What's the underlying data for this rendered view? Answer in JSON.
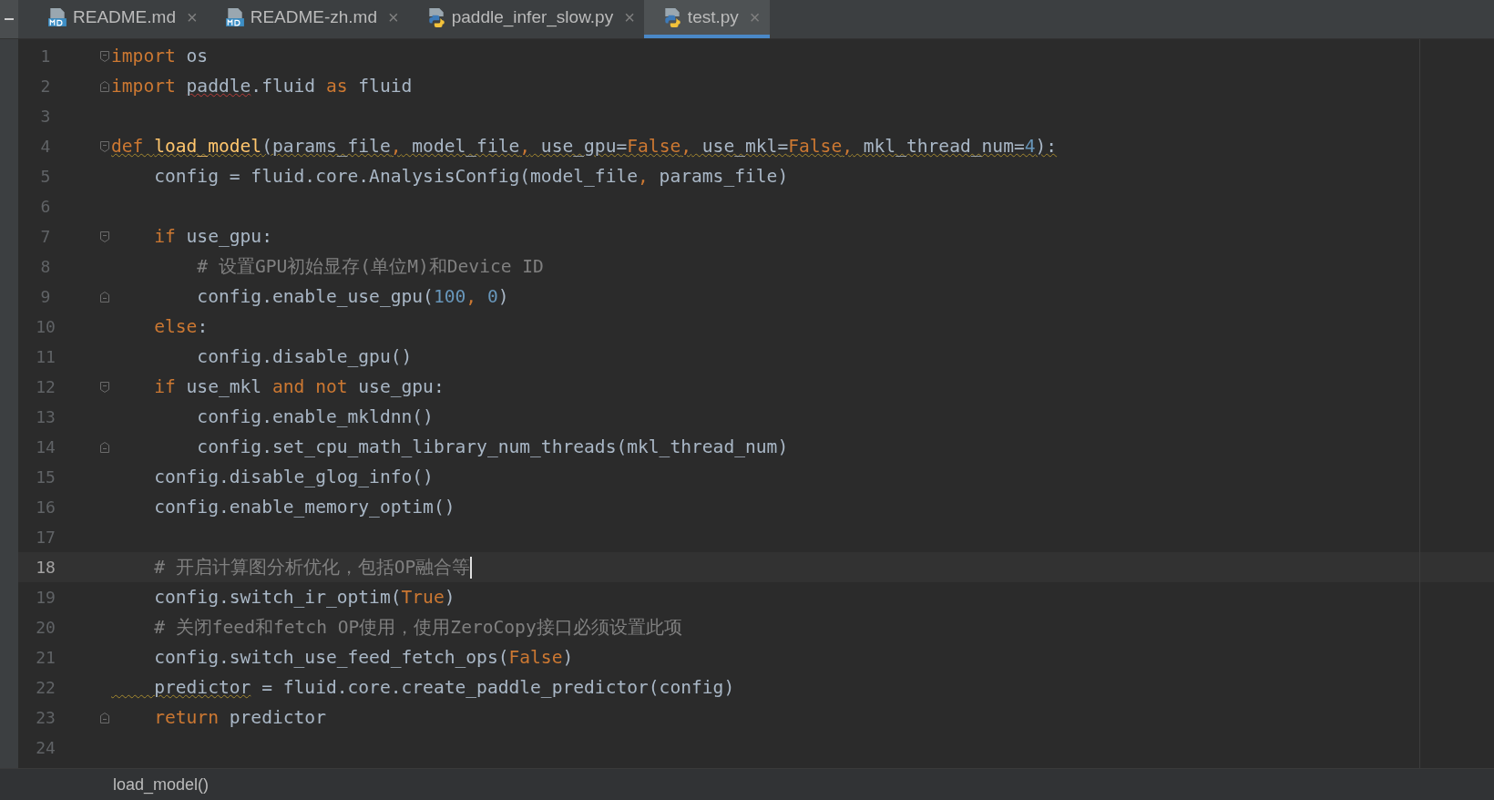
{
  "tabs": [
    {
      "label": "README.md",
      "kind": "md",
      "close": "×",
      "selected": false
    },
    {
      "label": "README-zh.md",
      "kind": "md",
      "close": "×",
      "selected": false
    },
    {
      "label": "paddle_infer_slow.py",
      "kind": "py",
      "close": "×",
      "selected": false
    },
    {
      "label": "test.py",
      "kind": "py",
      "close": "×",
      "selected": true
    }
  ],
  "editor": {
    "lines": [
      {
        "number": "1",
        "kind": "fold-start",
        "current": false,
        "tokens": [
          {
            "text": "import",
            "kind": "kw"
          },
          {
            "text": " os",
            "kind": "txt"
          }
        ]
      },
      {
        "number": "2",
        "kind": "fold-end",
        "current": false,
        "tokens": [
          {
            "text": "import ",
            "kind": "kw"
          },
          {
            "text": "paddle",
            "kind": "typo"
          },
          {
            "text": ".fluid ",
            "kind": "txt"
          },
          {
            "text": "as",
            "kind": "kw"
          },
          {
            "text": " fluid",
            "kind": "txt"
          }
        ]
      },
      {
        "number": "3",
        "kind": "plain",
        "current": false
      },
      {
        "number": "4",
        "kind": "fold-start",
        "current": false,
        "tokens": [
          {
            "text": "def ",
            "kind": "kw-warn"
          },
          {
            "text": "load_model",
            "kind": "fn-warn"
          },
          {
            "text": "(params_file",
            "kind": "warn"
          },
          {
            "text": ",",
            "kind": "kw-warn"
          },
          {
            "text": " model_file",
            "kind": "warn"
          },
          {
            "text": ",",
            "kind": "kw-warn"
          },
          {
            "text": " use_gpu=",
            "kind": "warn"
          },
          {
            "text": "False",
            "kind": "kw-warn"
          },
          {
            "text": ",",
            "kind": "kw-warn"
          },
          {
            "text": " use_mkl=",
            "kind": "warn"
          },
          {
            "text": "False",
            "kind": "kw-warn"
          },
          {
            "text": ",",
            "kind": "kw-warn"
          },
          {
            "text": " mkl_thread_num=",
            "kind": "warn"
          },
          {
            "text": "4",
            "kind": "num-warn"
          },
          {
            "text": "):",
            "kind": "warn"
          }
        ]
      },
      {
        "number": "5",
        "kind": "plain",
        "current": false,
        "tokens": [
          {
            "text": "    config = fluid.core.AnalysisConfig(model_file",
            "kind": "txt"
          },
          {
            "text": ",",
            "kind": "kw"
          },
          {
            "text": " params_file)",
            "kind": "txt"
          }
        ]
      },
      {
        "number": "6",
        "kind": "plain",
        "current": false
      },
      {
        "number": "7",
        "kind": "fold-start",
        "current": false,
        "tokens": [
          {
            "text": "    if",
            "kind": "kw"
          },
          {
            "text": " use_gpu:",
            "kind": "txt"
          }
        ]
      },
      {
        "number": "8",
        "kind": "plain",
        "current": false,
        "tokens": [
          {
            "text": "        # 设置GPU初始显存(单位M)和Device ID",
            "kind": "cmt"
          }
        ]
      },
      {
        "number": "9",
        "kind": "fold-end",
        "current": false,
        "tokens": [
          {
            "text": "        config.enable_use_gpu(",
            "kind": "txt"
          },
          {
            "text": "100",
            "kind": "num"
          },
          {
            "text": ",",
            "kind": "kw"
          },
          {
            "text": " 0",
            "kind": "num"
          },
          {
            "text": ")",
            "kind": "txt"
          }
        ]
      },
      {
        "number": "10",
        "kind": "plain",
        "current": false,
        "tokens": [
          {
            "text": "    else",
            "kind": "kw"
          },
          {
            "text": ":",
            "kind": "txt"
          }
        ]
      },
      {
        "number": "11",
        "kind": "plain",
        "current": false,
        "tokens": [
          {
            "text": "        config.disable_gpu()",
            "kind": "txt"
          }
        ]
      },
      {
        "number": "12",
        "kind": "fold-start",
        "current": false,
        "tokens": [
          {
            "text": "    if",
            "kind": "kw"
          },
          {
            "text": " use_mkl ",
            "kind": "txt"
          },
          {
            "text": "and not",
            "kind": "kw"
          },
          {
            "text": " use_gpu:",
            "kind": "txt"
          }
        ]
      },
      {
        "number": "13",
        "kind": "plain",
        "current": false,
        "tokens": [
          {
            "text": "        config.enable_mkldnn()",
            "kind": "txt"
          }
        ]
      },
      {
        "number": "14",
        "kind": "fold-end",
        "current": false,
        "tokens": [
          {
            "text": "        config.set_cpu_math_library_num_threads(mkl_thread_num)",
            "kind": "txt"
          }
        ]
      },
      {
        "number": "15",
        "kind": "plain",
        "current": false,
        "tokens": [
          {
            "text": "    config.disable_glog_info()",
            "kind": "txt"
          }
        ]
      },
      {
        "number": "16",
        "kind": "plain",
        "current": false,
        "tokens": [
          {
            "text": "    config.enable_memory_optim()",
            "kind": "txt"
          }
        ]
      },
      {
        "number": "17",
        "kind": "plain",
        "current": false
      },
      {
        "number": "18",
        "kind": "plain",
        "current": true,
        "tokens": [
          {
            "text": "    # 开启计算图分析优化，包括OP融合等",
            "kind": "cmt"
          }
        ]
      },
      {
        "number": "19",
        "kind": "plain",
        "current": false,
        "tokens": [
          {
            "text": "    config.switch_ir_optim(",
            "kind": "txt"
          },
          {
            "text": "True",
            "kind": "kw"
          },
          {
            "text": ")",
            "kind": "txt"
          }
        ]
      },
      {
        "number": "20",
        "kind": "plain",
        "current": false,
        "tokens": [
          {
            "text": "    # 关闭feed和fetch OP使用，使用ZeroCopy接口必须设置此项",
            "kind": "cmt"
          }
        ]
      },
      {
        "number": "21",
        "kind": "plain",
        "current": false,
        "tokens": [
          {
            "text": "    config.switch_use_feed_fetch_ops(",
            "kind": "txt"
          },
          {
            "text": "False",
            "kind": "kw"
          },
          {
            "text": ")",
            "kind": "txt"
          }
        ]
      },
      {
        "number": "22",
        "kind": "plain",
        "current": false,
        "tokens": [
          {
            "text": "    predictor",
            "kind": "warn"
          },
          {
            "text": " = fluid.core.create_paddle_predictor(config)",
            "kind": "txt"
          }
        ]
      },
      {
        "number": "23",
        "kind": "fold-end",
        "current": false,
        "tokens": [
          {
            "text": "    return",
            "kind": "kw"
          },
          {
            "text": " predictor",
            "kind": "txt"
          }
        ]
      },
      {
        "number": "24",
        "kind": "plain",
        "current": false
      }
    ]
  },
  "breadcrumb": "load_model()"
}
